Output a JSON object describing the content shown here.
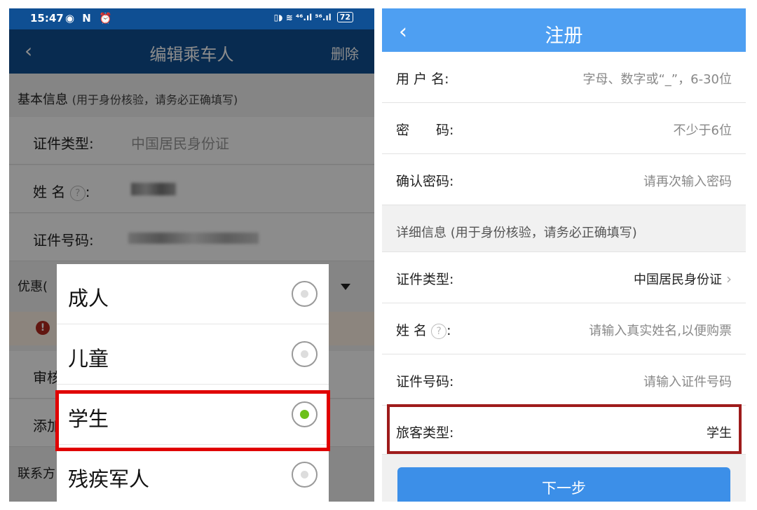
{
  "left": {
    "status": {
      "time": "15:47",
      "left_icons": "◉ N ⏰",
      "right_icons": "▯◗ ≋ ⁴⁶.ıl ⁵⁶.ıl",
      "battery": "72"
    },
    "header": {
      "back_icon": "‹",
      "title": "编辑乘车人",
      "delete_label": "删除"
    },
    "basic_section": {
      "title": "基本信息",
      "note": "(用于身份核验，请务必正确填写)"
    },
    "rows": {
      "id_type_label": "证件类型:",
      "id_type_value": "中国居民身份证",
      "name_label": "姓 名",
      "name_help": "?",
      "name_colon": ":",
      "id_number_label": "证件号码:"
    },
    "partial": {
      "discount": "优惠(",
      "review": "审核",
      "add": "添加",
      "contact": "联系方",
      "warn_icon": "!"
    },
    "picker": {
      "options": [
        "成人",
        "儿童",
        "学生",
        "残疾军人"
      ],
      "selected": "学生"
    }
  },
  "right": {
    "header": {
      "back_icon": "‹",
      "title": "注册"
    },
    "rows": {
      "username_label": "用 户 名:",
      "username_placeholder": "字母、数字或“_”，6-30位",
      "password_label": "密　　码:",
      "password_placeholder": "不少于6位",
      "confirm_label": "确认密码:",
      "confirm_placeholder": "请再次输入密码"
    },
    "detail_section": "详细信息 (用于身份核验，请务必正确填写)",
    "rows2": {
      "id_type_label": "证件类型:",
      "id_type_value": "中国居民身份证",
      "name_label": "姓 名",
      "name_help": "?",
      "name_colon": ":",
      "name_placeholder": "请输入真实姓名,以便购票",
      "id_number_label": "证件号码:",
      "id_number_placeholder": "请输入证件号码",
      "passenger_type_label": "旅客类型:",
      "passenger_type_value": "学生"
    },
    "next_button": "下一步"
  },
  "colors": {
    "left_header": "#0f4f93",
    "right_header": "#4e9ff2",
    "highlight_red": "#e00000",
    "highlight_dark_red": "#9e1b1b",
    "radio_selected": "#6cc01a",
    "button_blue": "#3c8fe8"
  }
}
